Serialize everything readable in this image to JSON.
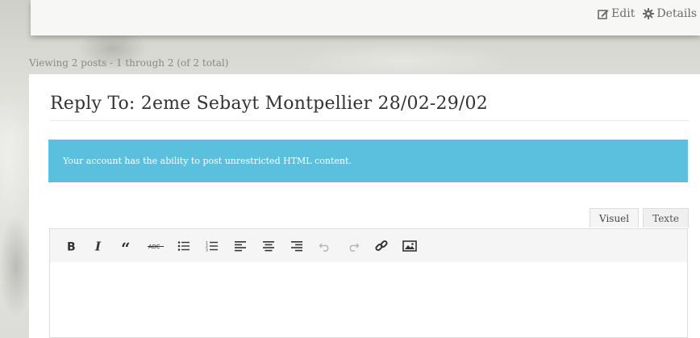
{
  "header": {
    "edit_label": "Edit",
    "details_label": "Details"
  },
  "viewing": {
    "text": "Viewing 2 posts - 1 through 2 (of 2 total)"
  },
  "reply": {
    "title": "Reply To: 2eme Sebayt Montpellier 28/02-29/02"
  },
  "notice": {
    "text": "Your account has the ability to post unrestricted HTML content.",
    "color": "#5bc0de"
  },
  "editor": {
    "tabs": [
      {
        "label": "Visuel",
        "active": true
      },
      {
        "label": "Texte",
        "active": false
      }
    ],
    "toolbar": [
      {
        "icon": "bold-icon"
      },
      {
        "icon": "italic-icon"
      },
      {
        "icon": "blockquote-icon"
      },
      {
        "icon": "strikethrough-icon"
      },
      {
        "icon": "bulleted-list-icon"
      },
      {
        "icon": "numbered-list-icon"
      },
      {
        "icon": "align-left-icon"
      },
      {
        "icon": "align-center-icon"
      },
      {
        "icon": "align-right-icon"
      },
      {
        "icon": "undo-icon",
        "disabled": true
      },
      {
        "icon": "redo-icon",
        "disabled": true
      },
      {
        "icon": "link-icon"
      },
      {
        "icon": "image-icon"
      }
    ],
    "content": ""
  }
}
